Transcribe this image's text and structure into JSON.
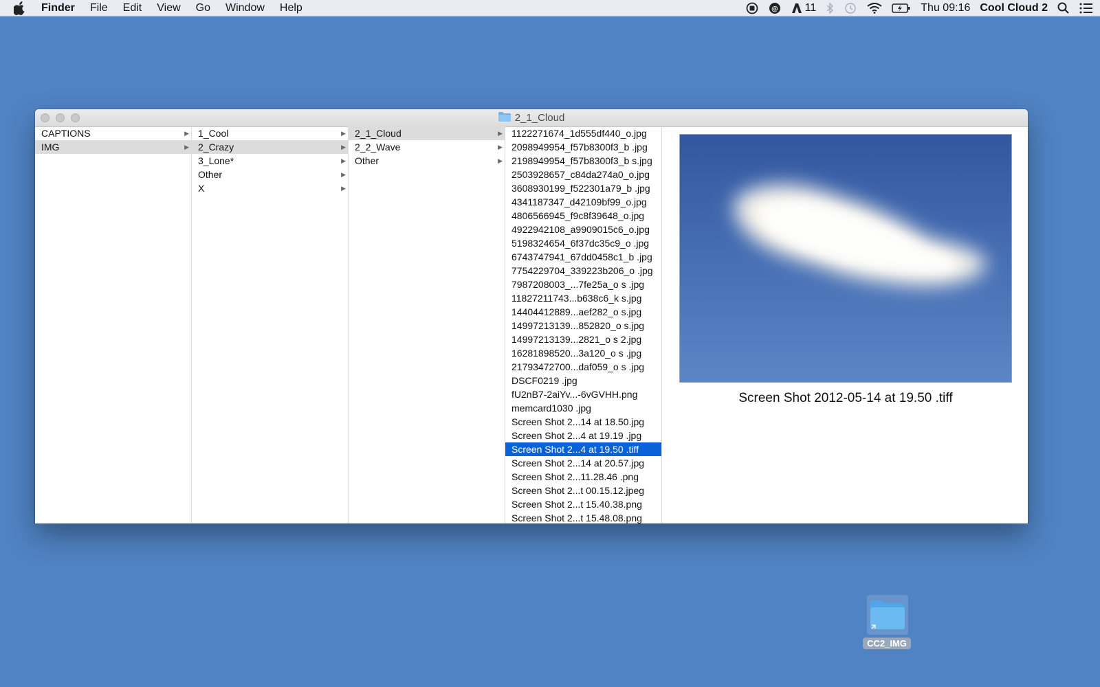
{
  "menubar": {
    "app_name": "Finder",
    "menus": [
      "File",
      "Edit",
      "View",
      "Go",
      "Window",
      "Help"
    ],
    "status": {
      "adobe_count": "11",
      "clock": "Thu 09:16",
      "user": "Cool Cloud 2"
    }
  },
  "window": {
    "title": "2_1_Cloud",
    "columns": [
      {
        "items": [
          {
            "label": "CAPTIONS",
            "has_children": true,
            "state": "none"
          },
          {
            "label": "IMG",
            "has_children": true,
            "state": "selected-inactive"
          }
        ]
      },
      {
        "items": [
          {
            "label": "1_Cool",
            "has_children": true,
            "state": "none"
          },
          {
            "label": "2_Crazy",
            "has_children": true,
            "state": "selected-inactive"
          },
          {
            "label": "3_Lone*",
            "has_children": true,
            "state": "none"
          },
          {
            "label": "Other",
            "has_children": true,
            "state": "none"
          },
          {
            "label": "X",
            "has_children": true,
            "state": "none"
          }
        ]
      },
      {
        "items": [
          {
            "label": "2_1_Cloud",
            "has_children": true,
            "state": "selected-inactive"
          },
          {
            "label": "2_2_Wave",
            "has_children": true,
            "state": "none"
          },
          {
            "label": "Other",
            "has_children": true,
            "state": "none"
          }
        ]
      },
      {
        "items": [
          {
            "label": "1122271674_1d555df440_o.jpg",
            "state": "none"
          },
          {
            "label": "2098949954_f57b8300f3_b .jpg",
            "state": "none"
          },
          {
            "label": "2198949954_f57b8300f3_b s.jpg",
            "state": "none"
          },
          {
            "label": "2503928657_c84da274a0_o.jpg",
            "state": "none"
          },
          {
            "label": "3608930199_f522301a79_b .jpg",
            "state": "none"
          },
          {
            "label": "4341187347_d42109bf99_o.jpg",
            "state": "none"
          },
          {
            "label": "4806566945_f9c8f39648_o.jpg",
            "state": "none"
          },
          {
            "label": "4922942108_a9909015c6_o.jpg",
            "state": "none"
          },
          {
            "label": "5198324654_6f37dc35c9_o  .jpg",
            "state": "none"
          },
          {
            "label": "6743747941_67dd0458c1_b .jpg",
            "state": "none"
          },
          {
            "label": "7754229704_339223b206_o .jpg",
            "state": "none"
          },
          {
            "label": "7987208003_...7fe25a_o s .jpg",
            "state": "none"
          },
          {
            "label": "11827211743...b638c6_k s.jpg",
            "state": "none"
          },
          {
            "label": "14404412889...aef282_o s.jpg",
            "state": "none"
          },
          {
            "label": "14997213139...852820_o s.jpg",
            "state": "none"
          },
          {
            "label": "14997213139...2821_o s 2.jpg",
            "state": "none"
          },
          {
            "label": "16281898520...3a120_o s .jpg",
            "state": "none"
          },
          {
            "label": "21793472700...daf059_o s .jpg",
            "state": "none"
          },
          {
            "label": "DSCF0219 .jpg",
            "state": "none"
          },
          {
            "label": "fU2nB7-2aiYv...-6vGVHH.png",
            "state": "none"
          },
          {
            "label": "memcard1030 .jpg",
            "state": "none"
          },
          {
            "label": "Screen Shot 2...14 at 18.50.jpg",
            "state": "none"
          },
          {
            "label": "Screen Shot 2...4 at 19.19 .jpg",
            "state": "none"
          },
          {
            "label": "Screen Shot 2...4 at 19.50 .tiff",
            "state": "selected"
          },
          {
            "label": "Screen Shot 2...14 at 20.57.jpg",
            "state": "none"
          },
          {
            "label": "Screen Shot 2...11.28.46 .png",
            "state": "none"
          },
          {
            "label": "Screen Shot 2...t 00.15.12.jpeg",
            "state": "none"
          },
          {
            "label": "Screen Shot 2...t 15.40.38.png",
            "state": "none"
          },
          {
            "label": "Screen Shot 2...t 15.48.08.png",
            "state": "none"
          }
        ]
      }
    ],
    "preview": {
      "caption": "Screen Shot 2012-05-14 at 19.50 .tiff"
    }
  },
  "desktop": {
    "folder_label": "CC2_IMG"
  },
  "colors": {
    "desktop": "#5083c3",
    "selection": "#0a62d8",
    "inactive_selection": "#dcdcdc"
  }
}
